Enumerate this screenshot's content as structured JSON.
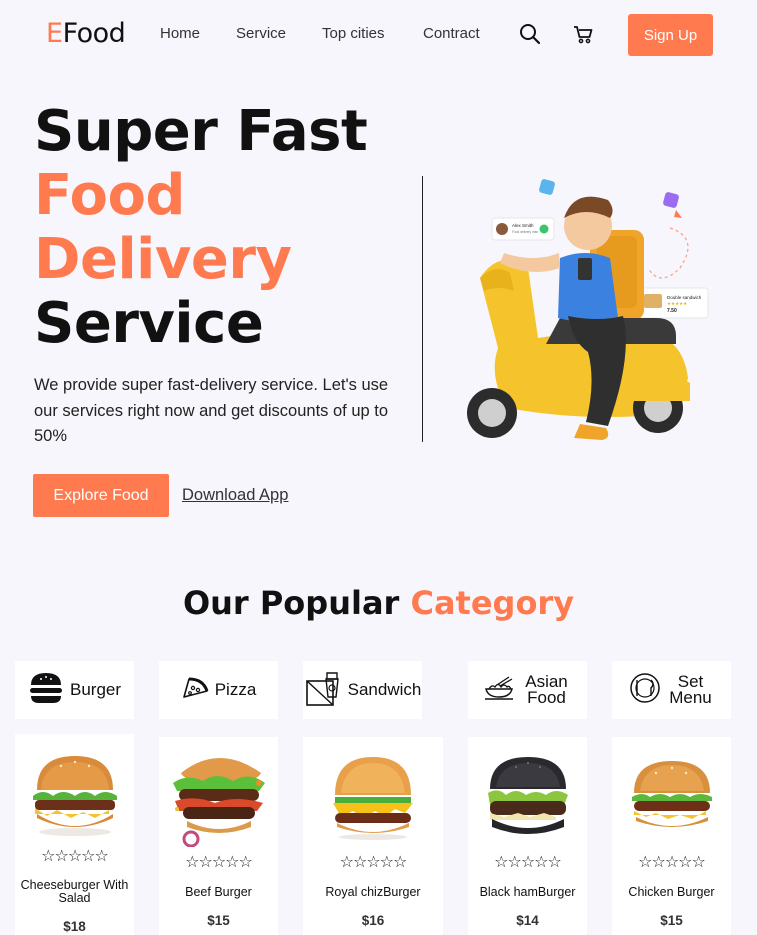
{
  "brand": {
    "logo_first": "E",
    "logo_rest": "Food"
  },
  "nav": {
    "links": [
      "Home",
      "Service",
      "Top cities",
      "Contract"
    ],
    "signup_label": "Sign Up"
  },
  "hero": {
    "title_line1": "Super Fast",
    "title_line2": "Food",
    "title_line3": "Delivery",
    "title_line4": "Service",
    "description": "We provide super fast-delivery service. Let's use our services right now and get discounts of up to 50%",
    "explore_label": "Explore Food",
    "download_label": "Download App",
    "badge_name": "Alex Smith",
    "badge_subtitle": "Food delivery man",
    "badge2_title": "Double sandwich",
    "badge2_price": "7.50"
  },
  "category_section": {
    "title_part1": "Our Popular",
    "title_part2": "Category",
    "categories": [
      {
        "label": "Burger",
        "icon": "burger-icon"
      },
      {
        "label": "Pizza",
        "icon": "pizza-icon"
      },
      {
        "label": "Sandwich",
        "icon": "sandwich-icon"
      },
      {
        "label": "Asian Food",
        "icon": "asian-food-icon"
      },
      {
        "label": "Set Menu",
        "icon": "set-menu-icon"
      }
    ]
  },
  "products": [
    {
      "name": "Cheeseburger With Salad",
      "price": "$18",
      "rating": "☆☆☆☆☆"
    },
    {
      "name": "Beef Burger",
      "price": "$15",
      "rating": "☆☆☆☆☆"
    },
    {
      "name": "Royal chizBurger",
      "price": "$16",
      "rating": "☆☆☆☆☆"
    },
    {
      "name": "Black hamBurger",
      "price": "$14",
      "rating": "☆☆☆☆☆"
    },
    {
      "name": "Chicken Burger",
      "price": "$15",
      "rating": "☆☆☆☆☆"
    }
  ],
  "colors": {
    "accent": "#ff7a4f",
    "background": "#f7f6fc",
    "text": "#111111"
  }
}
